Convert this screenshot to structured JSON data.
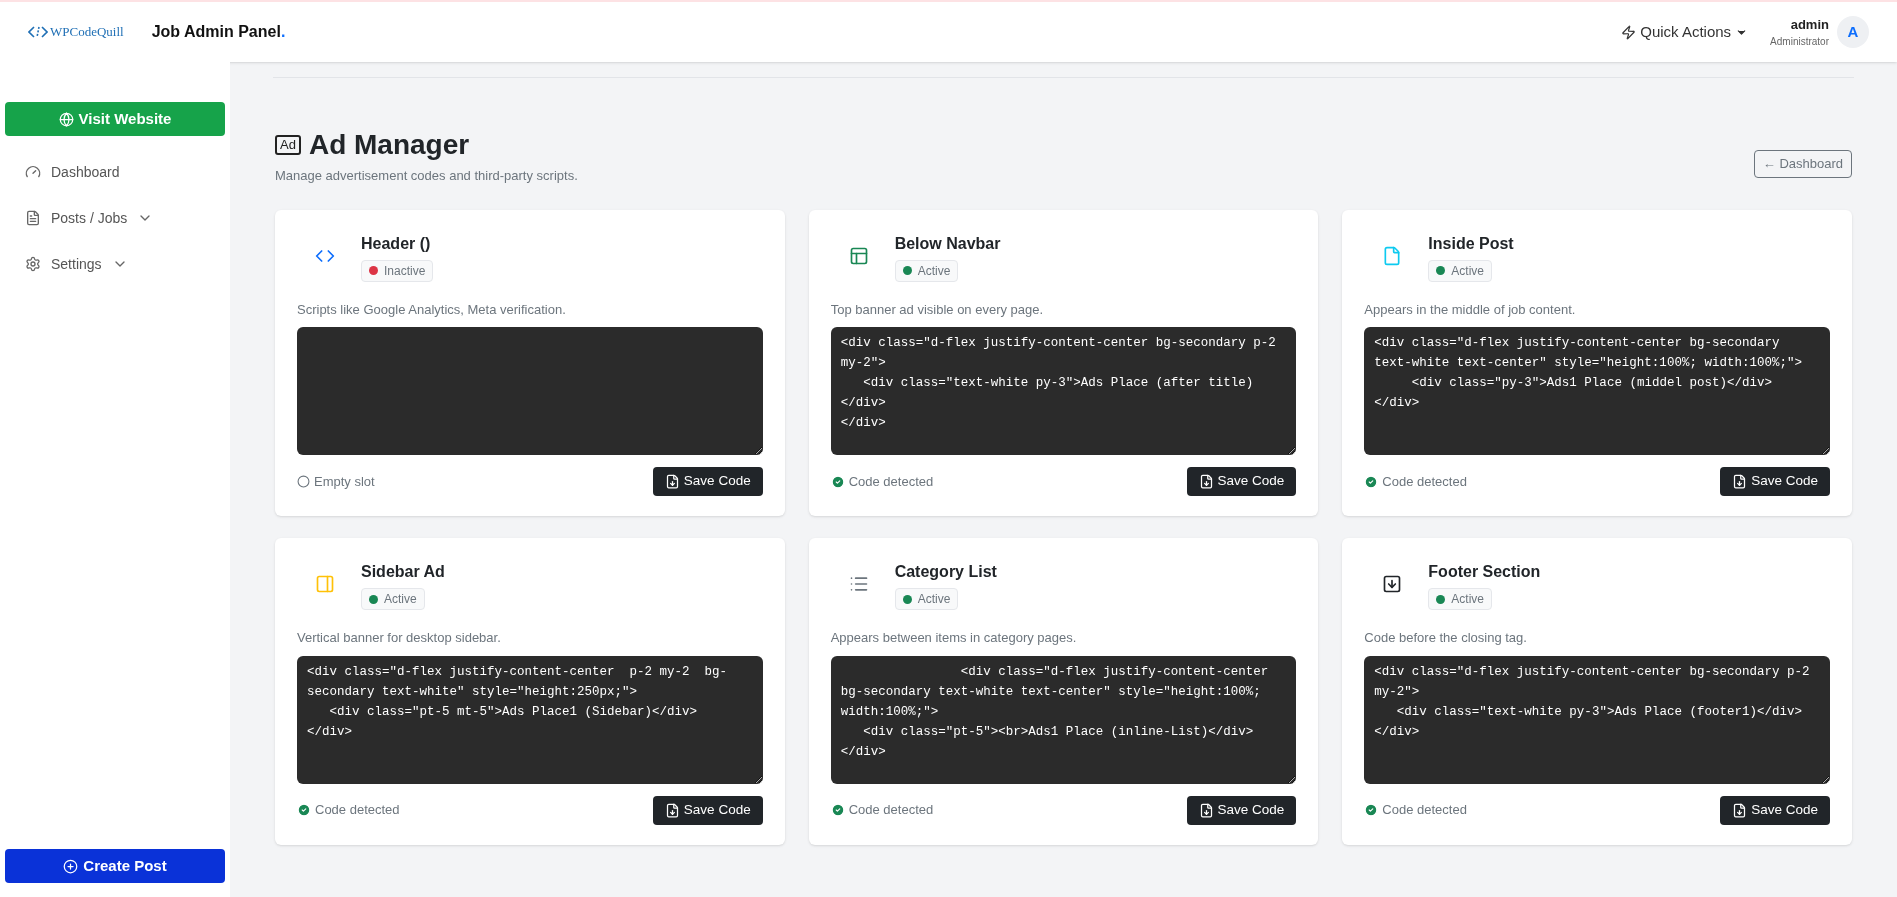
{
  "header": {
    "logo": "WPCodeQuill",
    "title": "Job Admin Panel",
    "title_dot": ".",
    "quick_actions": "Quick Actions",
    "user": {
      "name": "admin",
      "role": "Administrator",
      "initial": "A"
    }
  },
  "sidebar": {
    "visit_button": "Visit Website",
    "items": [
      {
        "label": "Dashboard",
        "kind": "link"
      },
      {
        "label": "Posts / Jobs",
        "kind": "group"
      },
      {
        "label": "Settings",
        "kind": "group"
      }
    ],
    "create_button": "Create Post"
  },
  "page": {
    "icon_label": "Ad",
    "title": "Ad Manager",
    "subtitle": "Manage advertisement codes and third-party scripts.",
    "back_button": "← Dashboard"
  },
  "cards": [
    {
      "title": "Header ()",
      "active": false,
      "status": "Inactive",
      "description": "Scripts like Google Analytics, Meta verification.",
      "detection": {
        "kind": "empty",
        "text": "Empty slot"
      },
      "save": "Save Code"
    },
    {
      "title": "Below Navbar",
      "active": true,
      "status": "Active",
      "description": "Top banner ad visible on every page.",
      "code": "<div class=\"d-flex justify-content-center bg-secondary p-2 my-2\">\n   <div class=\"text-white py-3\">Ads Place (after title)</div>\n</div>",
      "detection": {
        "kind": "detected",
        "text": "Code detected"
      },
      "save": "Save Code"
    },
    {
      "title": "Inside Post",
      "active": true,
      "status": "Active",
      "description": "Appears in the middle of job content.",
      "code": "<div class=\"d-flex justify-content-center bg-secondary text-white text-center\" style=\"height:100%; width:100%;\">\n     <div class=\"py-3\">Ads1 Place (middel post)</div>\n</div>",
      "detection": {
        "kind": "detected",
        "text": "Code detected"
      },
      "save": "Save Code"
    },
    {
      "title": "Sidebar Ad",
      "active": true,
      "status": "Active",
      "description": "Vertical banner for desktop sidebar.",
      "code": "<div class=\"d-flex justify-content-center  p-2 my-2  bg-secondary text-white\" style=\"height:250px;\">\n   <div class=\"pt-5 mt-5\">Ads Place1 (Sidebar)</div>\n</div>",
      "detection": {
        "kind": "detected",
        "text": "Code detected"
      },
      "save": "Save Code"
    },
    {
      "title": "Category List",
      "active": true,
      "status": "Active",
      "description": "Appears between items in category pages.",
      "code": "                <div class=\"d-flex justify-content-center bg-secondary text-white text-center\" style=\"height:100%; width:100%;\">\n   <div class=\"pt-5\"><br>Ads1 Place (inline-List)</div>\n</div>",
      "detection": {
        "kind": "detected",
        "text": "Code detected"
      },
      "save": "Save Code"
    },
    {
      "title": "Footer Section",
      "active": true,
      "status": "Active",
      "description": "Code before the closing tag.",
      "code": "<div class=\"d-flex justify-content-center bg-secondary p-2 my-2\">\n   <div class=\"text-white py-3\">Ads Place (footer1)</div>\n</div>",
      "detection": {
        "kind": "detected",
        "text": "Code detected"
      },
      "save": "Save Code"
    }
  ]
}
